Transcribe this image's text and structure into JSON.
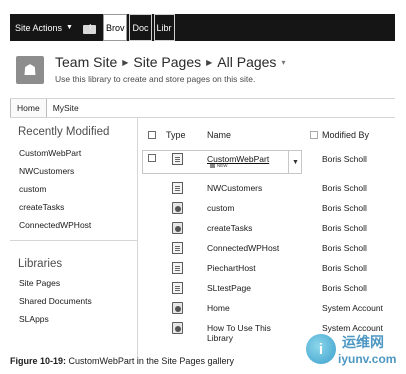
{
  "ribbon": {
    "site_actions": "Site Actions",
    "tabs": [
      "Brov",
      "Doc",
      "Libr"
    ]
  },
  "title": {
    "crumbs": [
      "Team Site",
      "Site Pages",
      "All Pages"
    ],
    "subtitle": "Use this library to create and store pages on this site."
  },
  "topnav": {
    "tabs": [
      "Home",
      "MySite"
    ]
  },
  "quicklaunch": {
    "recent_heading": "Recently Modified",
    "recent_items": [
      "CustomWebPart",
      "NWCustomers",
      "custom",
      "createTasks",
      "ConnectedWPHost"
    ],
    "libraries_heading": "Libraries",
    "library_items": [
      "Site Pages",
      "Shared Documents",
      "SLApps"
    ]
  },
  "list": {
    "columns": {
      "type": "Type",
      "name": "Name",
      "modified_by": "Modified By"
    },
    "new_label": "NEW",
    "rows": [
      {
        "name": "CustomWebPart",
        "icon": "doc-icon",
        "modified_by": "Boris Scholl"
      },
      {
        "name": "NWCustomers",
        "icon": "doc-icon",
        "modified_by": "Boris Scholl"
      },
      {
        "name": "custom",
        "icon": "web-icon",
        "modified_by": "Boris Scholl"
      },
      {
        "name": "createTasks",
        "icon": "web-icon",
        "modified_by": "Boris Scholl"
      },
      {
        "name": "ConnectedWPHost",
        "icon": "doc-icon",
        "modified_by": "Boris Scholl"
      },
      {
        "name": "PiechartHost",
        "icon": "doc-icon",
        "modified_by": "Boris Scholl"
      },
      {
        "name": "SLtestPage",
        "icon": "doc-icon",
        "modified_by": "Boris Scholl"
      },
      {
        "name": "Home",
        "icon": "web-icon",
        "modified_by": "System Account"
      },
      {
        "name": "How To Use This Library",
        "icon": "web-icon",
        "modified_by": "System Account"
      }
    ]
  },
  "caption": {
    "figure": "Figure 10-19:",
    "text": "CustomWebPart in the Site Pages gallery"
  },
  "watermark": {
    "cn": "运维网",
    "en": "iyunv.com",
    "logo_letter": "i"
  }
}
